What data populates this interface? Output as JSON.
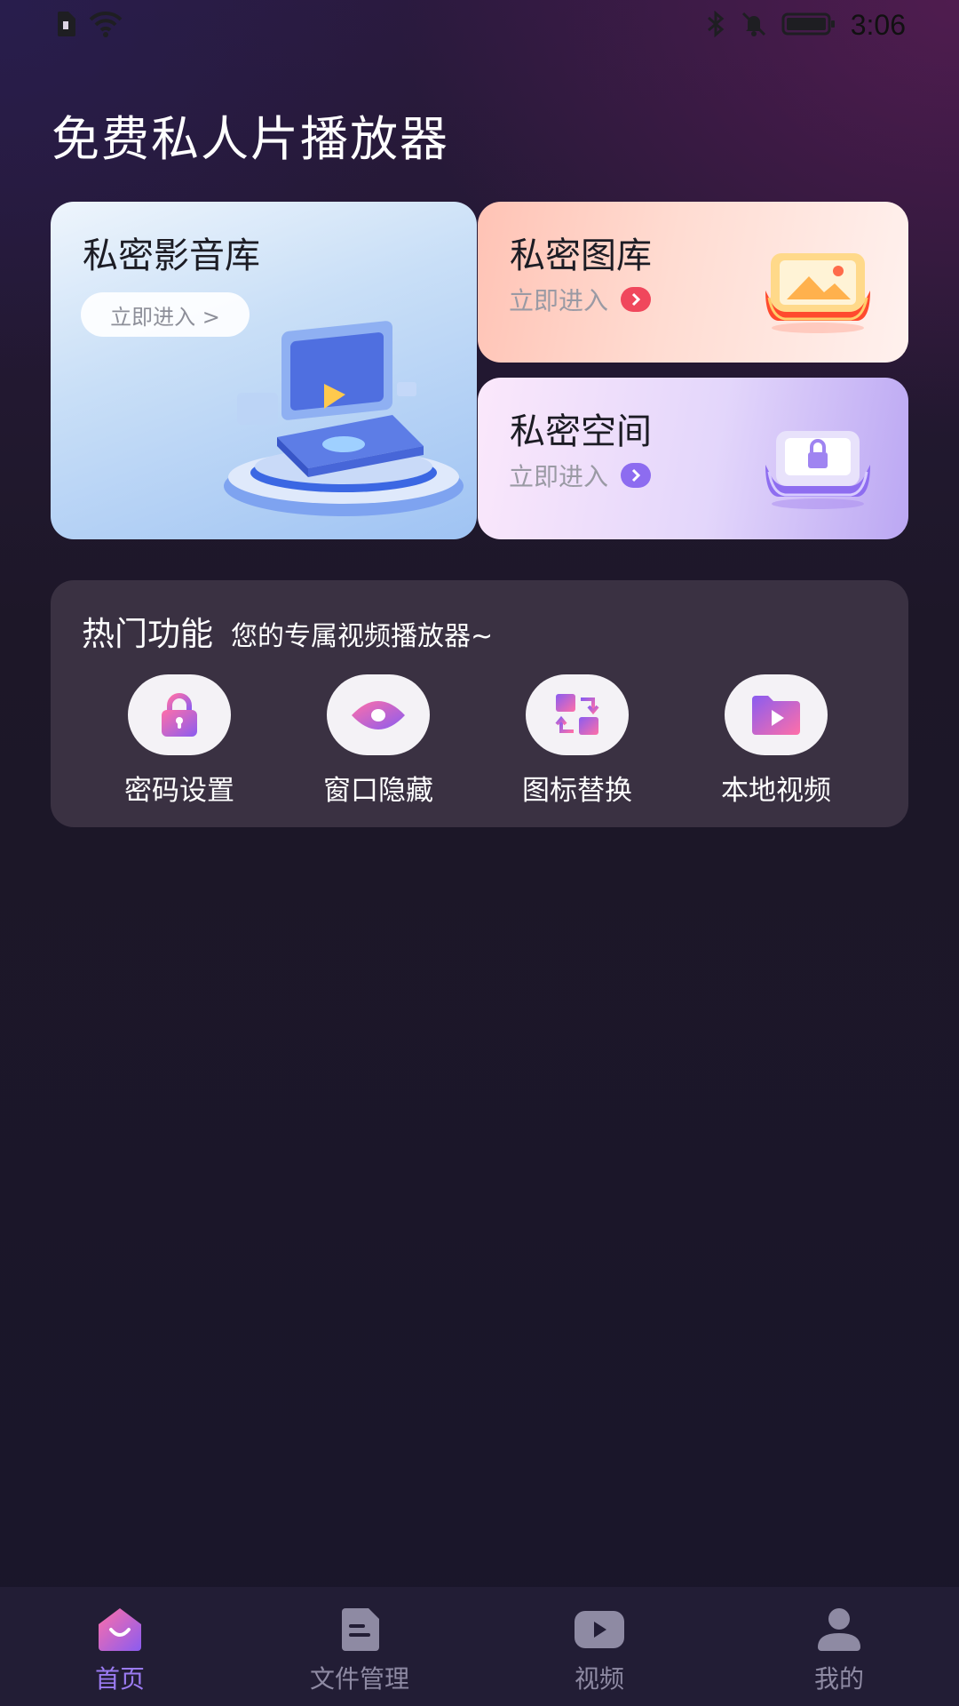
{
  "status_bar": {
    "time": "3:06",
    "icons": [
      "sim-card-icon",
      "wifi-icon",
      "bluetooth-icon",
      "bell-muted-icon",
      "battery-icon"
    ]
  },
  "app": {
    "title": "免费私人片播放器"
  },
  "cards": {
    "video_library": {
      "title": "私密影音库",
      "action": "立即进入 >"
    },
    "gallery": {
      "title": "私密图库",
      "action": "立即进入",
      "badge_color": "#f0475c"
    },
    "space": {
      "title": "私密空间",
      "action": "立即进入",
      "badge_color": "#8d6cf0"
    }
  },
  "hot": {
    "title": "热门功能",
    "subtitle": "您的专属视频播放器~",
    "items": [
      {
        "label": "密码设置",
        "icon": "lock-icon"
      },
      {
        "label": "窗口隐藏",
        "icon": "eye-icon"
      },
      {
        "label": "图标替换",
        "icon": "swap-icon"
      },
      {
        "label": "本地视频",
        "icon": "video-folder-icon"
      }
    ]
  },
  "nav": {
    "items": [
      {
        "label": "首页",
        "icon": "home-icon",
        "active": true
      },
      {
        "label": "文件管理",
        "icon": "file-icon",
        "active": false
      },
      {
        "label": "视频",
        "icon": "play-icon",
        "active": false
      },
      {
        "label": "我的",
        "icon": "user-icon",
        "active": false
      }
    ],
    "active_color": "#9b7bf2",
    "inactive_color": "#8e8aa3"
  }
}
